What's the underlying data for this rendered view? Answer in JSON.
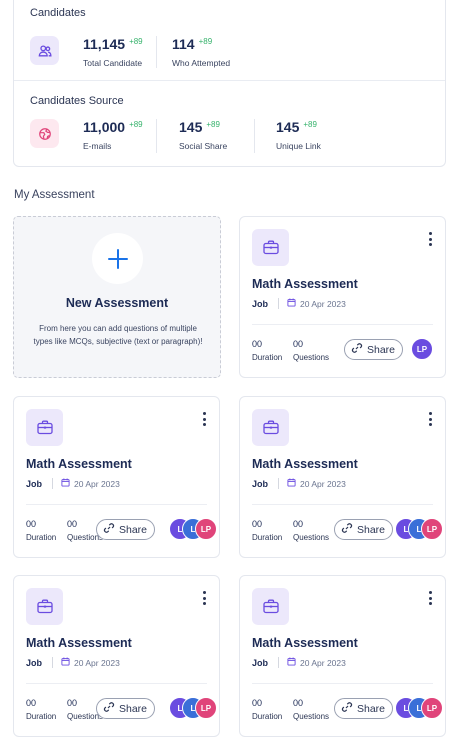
{
  "candidates": {
    "title": "Candidates",
    "stats": [
      {
        "value": "11,145",
        "delta": "+89",
        "label": "Total Candidate"
      },
      {
        "value": "114",
        "delta": "+89",
        "label": "Who Attempted"
      }
    ],
    "icon": "users-icon",
    "icon_color": "#6a4ce0"
  },
  "candidates_source": {
    "title": "Candidates Source",
    "stats": [
      {
        "value": "11,000",
        "delta": "+89",
        "label": "E-mails"
      },
      {
        "value": "145",
        "delta": "+89",
        "label": "Social Share"
      },
      {
        "value": "145",
        "delta": "+89",
        "label": "Unique Link"
      }
    ],
    "icon": "globe-icon",
    "icon_color": "#e0447a"
  },
  "my_assessment": {
    "heading": "My Assessment",
    "new_card": {
      "title": "New Assessment",
      "description": "From here you can add questions of multiple types like MCQs, subjective (text or paragraph)!"
    },
    "cards": [
      {
        "title": "Math Assessment",
        "type": "Job",
        "date": "20 Apr 2023",
        "duration_value": "00",
        "duration_label": "Duration",
        "questions_value": "00",
        "questions_label": "Questions",
        "share_label": "Share",
        "avatars": [
          "LP"
        ]
      },
      {
        "title": "Math Assessment",
        "type": "Job",
        "date": "20 Apr 2023",
        "duration_value": "00",
        "duration_label": "Duration",
        "questions_value": "00",
        "questions_label": "Questions",
        "share_label": "Share",
        "avatars": [
          "L",
          "L",
          "LP"
        ]
      },
      {
        "title": "Math Assessment",
        "type": "Job",
        "date": "20 Apr 2023",
        "duration_value": "00",
        "duration_label": "Duration",
        "questions_value": "00",
        "questions_label": "Questions",
        "share_label": "Share",
        "avatars": [
          "L",
          "L",
          "LP"
        ]
      },
      {
        "title": "Math Assessment",
        "type": "Job",
        "date": "20 Apr 2023",
        "duration_value": "00",
        "duration_label": "Duration",
        "questions_value": "00",
        "questions_label": "Questions",
        "share_label": "Share",
        "avatars": [
          "L",
          "L",
          "LP"
        ]
      },
      {
        "title": "Math Assessment",
        "type": "Job",
        "date": "20 Apr 2023",
        "duration_value": "00",
        "duration_label": "Duration",
        "questions_value": "00",
        "questions_label": "Questions",
        "share_label": "Share",
        "avatars": [
          "L",
          "L",
          "LP"
        ]
      }
    ]
  },
  "colors": {
    "accent": "#1a73e8",
    "positive": "#35b26b",
    "brand_purple": "#6a4ce0"
  }
}
